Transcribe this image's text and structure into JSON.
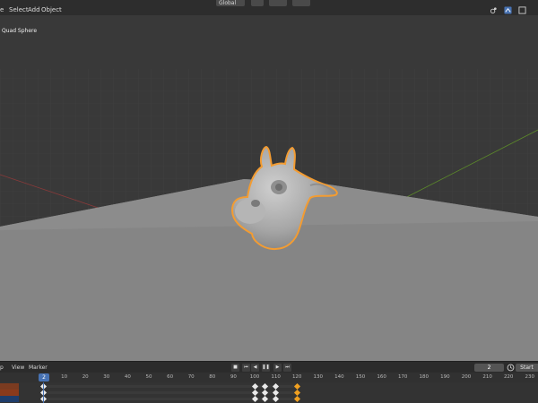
{
  "header": {
    "menus": [
      "e",
      "Select",
      "Add",
      "Object"
    ],
    "orientation_label": "Global",
    "right_icons": [
      "viewport-shading-icon",
      "overlay-icon",
      "xray-icon"
    ]
  },
  "viewport": {
    "object_label": "Quad Sphere",
    "active_object": "cow-head-mesh",
    "grid_axis_colors": {
      "x": "#8a3a3a",
      "y": "#5c8a2a"
    },
    "selection_outline_color": "#f39c32"
  },
  "timeline": {
    "menus": [
      "p",
      "View",
      "Marker"
    ],
    "current_frame": "2",
    "start_label": "Start",
    "playhead_frame": 2,
    "ruler_ticks": [
      "10",
      "20",
      "30",
      "40",
      "50",
      "60",
      "70",
      "80",
      "90",
      "100",
      "110",
      "120",
      "130",
      "140",
      "150",
      "160",
      "170",
      "180",
      "190",
      "200",
      "210",
      "220",
      "230"
    ],
    "keyframes": [
      {
        "row": 0,
        "frames": [
          0
        ],
        "color": "white"
      },
      {
        "row": 0,
        "frames": [
          100,
          105,
          110
        ],
        "color": "white"
      },
      {
        "row": 0,
        "frames": [
          120
        ],
        "color": "orange"
      },
      {
        "row": 1,
        "frames": [
          0
        ],
        "color": "white"
      },
      {
        "row": 1,
        "frames": [
          100,
          105,
          110
        ],
        "color": "white"
      },
      {
        "row": 1,
        "frames": [
          120
        ],
        "color": "orange"
      },
      {
        "row": 2,
        "frames": [
          0
        ],
        "color": "white"
      },
      {
        "row": 2,
        "frames": [
          100,
          105,
          110
        ],
        "color": "white"
      },
      {
        "row": 2,
        "frames": [
          120
        ],
        "color": "orange"
      }
    ],
    "track_colors": [
      "#7a3b20",
      "#8a3a1c",
      "#1f3d6b"
    ]
  }
}
